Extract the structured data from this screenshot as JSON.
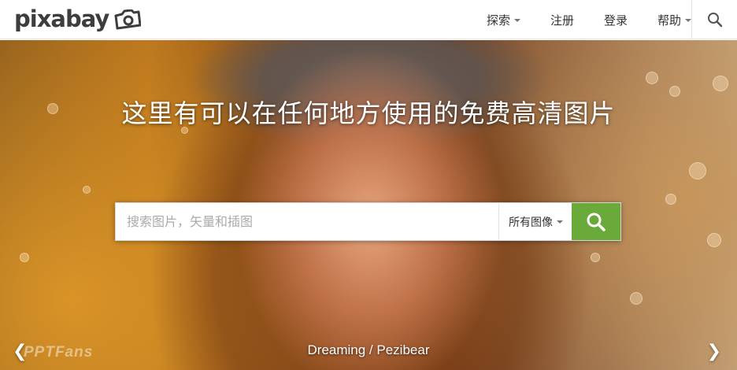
{
  "header": {
    "logo_text": "pixabay",
    "nav": [
      {
        "label": "探索",
        "dropdown": true
      },
      {
        "label": "注册",
        "dropdown": false
      },
      {
        "label": "登录",
        "dropdown": false
      },
      {
        "label": "帮助",
        "dropdown": true
      }
    ],
    "search_icon": "search-icon"
  },
  "hero": {
    "title": "这里有可以在任何地方使用的免费高清图片",
    "search": {
      "placeholder": "搜索图片，矢量和插图",
      "value": "",
      "type_selected": "所有图像",
      "submit_icon": "search-icon"
    },
    "caption": "Dreaming / Pezibear",
    "prev_icon": "chevron-left-icon",
    "next_icon": "chevron-right-icon",
    "watermark": "PPTFans"
  },
  "colors": {
    "accent": "#6aaa3b",
    "header_bg": "#ffffff",
    "text": "#333333"
  }
}
